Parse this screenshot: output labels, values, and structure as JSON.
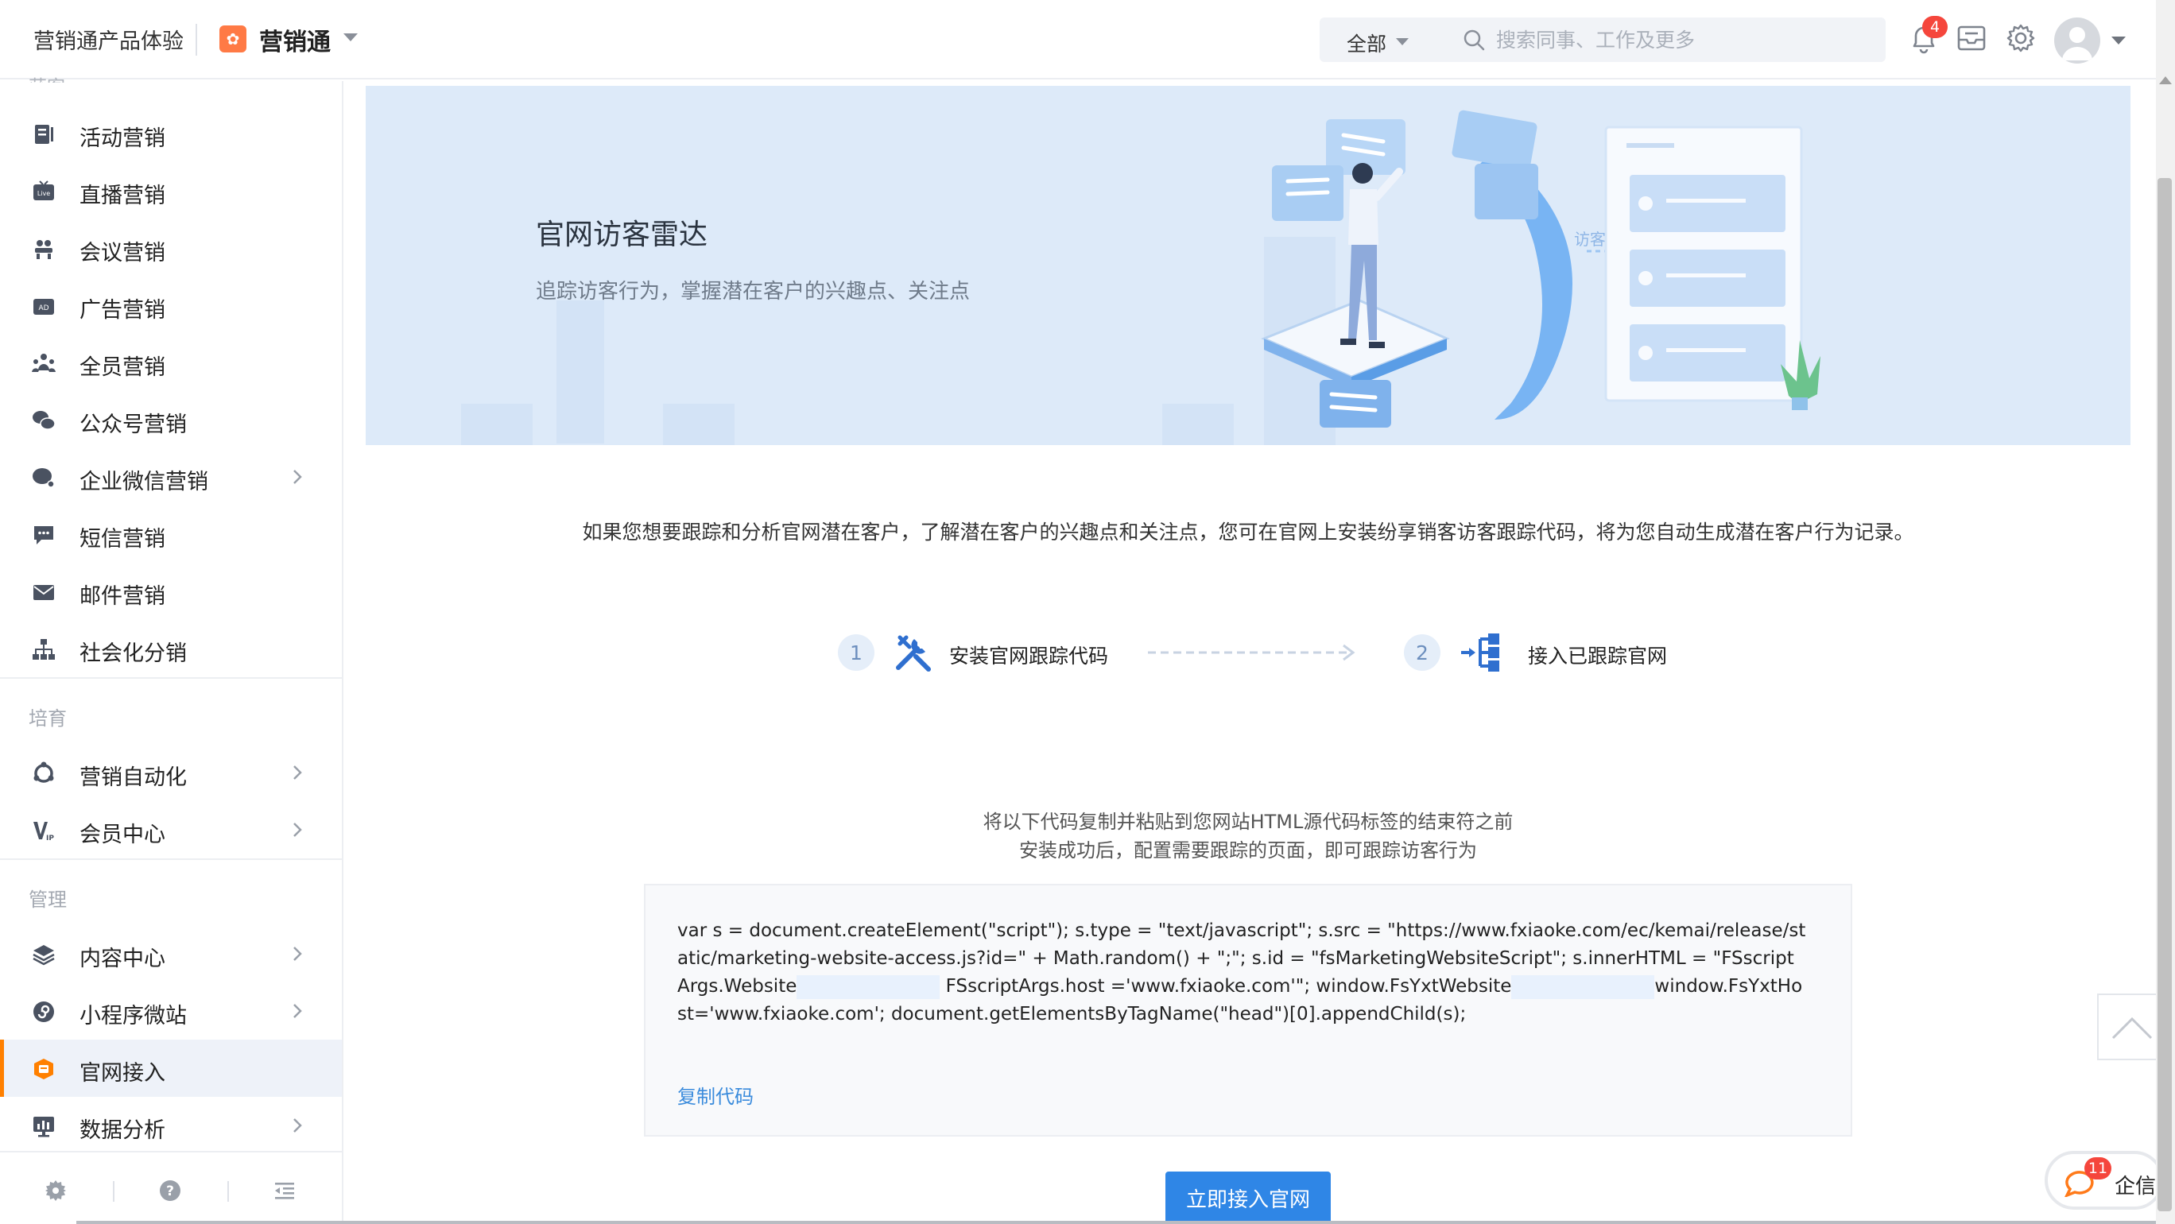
{
  "topbar": {
    "env_title": "营销通产品体验",
    "brand_name": "营销通",
    "scope": "全部",
    "search_placeholder": "搜索同事、工作及更多",
    "notification_count": "4"
  },
  "sidebar": {
    "cut_label": "获客",
    "groups": [
      {
        "items": [
          {
            "label": "活动营销",
            "icon": "activity-icon"
          },
          {
            "label": "直播营销",
            "icon": "live-icon"
          },
          {
            "label": "会议营销",
            "icon": "meeting-icon"
          },
          {
            "label": "广告营销",
            "icon": "ad-icon"
          },
          {
            "label": "全员营销",
            "icon": "people-icon"
          },
          {
            "label": "公众号营销",
            "icon": "wechat-icon"
          },
          {
            "label": "企业微信营销",
            "icon": "wecom-icon",
            "has_submenu": true
          },
          {
            "label": "短信营销",
            "icon": "sms-icon"
          },
          {
            "label": "邮件营销",
            "icon": "mail-icon"
          },
          {
            "label": "社会化分销",
            "icon": "tree-icon"
          }
        ]
      },
      {
        "title": "培育",
        "items": [
          {
            "label": "营销自动化",
            "icon": "automation-icon",
            "has_submenu": true
          },
          {
            "label": "会员中心",
            "icon": "vip-icon",
            "has_submenu": true
          }
        ]
      },
      {
        "title": "管理",
        "items": [
          {
            "label": "内容中心",
            "icon": "layers-icon",
            "has_submenu": true
          },
          {
            "label": "小程序微站",
            "icon": "miniprogram-icon",
            "has_submenu": true
          },
          {
            "label": "官网接入",
            "icon": "website-icon",
            "active": true
          },
          {
            "label": "数据分析",
            "icon": "chart-icon",
            "has_submenu": true
          }
        ]
      }
    ],
    "active_color": "#ff8000"
  },
  "banner": {
    "title": "官网访客雷达",
    "subtitle": "追踪访客行为，掌握潜在客户的兴趣点、关注点",
    "art_label": "访客行为"
  },
  "intro": "如果您想要跟踪和分析官网潜在客户，了解潜在客户的兴趣点和关注点，您可在官网上安装纷享销客访客跟踪代码，将为您自动生成潜在客户行为记录。",
  "steps": [
    {
      "number": "1",
      "label": "安装官网跟踪代码",
      "icon": "tools-icon"
    },
    {
      "number": "2",
      "label": "接入已跟踪官网",
      "icon": "connect-icon"
    }
  ],
  "instructions": {
    "line1": "将以下代码复制并粘贴到您网站HTML源代码标签的结束符之前",
    "line2": "安装成功后，配置需要跟踪的页面，即可跟踪访客行为"
  },
  "code": {
    "part1": "var s = document.createElement(\"script\"); s.type = \"text/javascript\"; s.src = \"https://www.fxiaoke.com/ec/kemai/release/static/marketing-website-access.js?id=\" + Math.random() + \";\"; s.id = \"fsMarketingWebsiteScript\"; s.innerHTML = \"FSscriptArgs.Website",
    "part2": " FSscriptArgs.host ='www.fxiaoke.com'\"; window.FsYxtWebsite",
    "part3": "window.FsYxtHost='www.fxiaoke.com'; document.getElementsByTagName(\"head\")[0].appendChild(s);",
    "copy_label": "复制代码"
  },
  "primary_button": "立即接入官网",
  "qixin": {
    "label": "企信",
    "count": "11"
  },
  "colors": {
    "primary": "#2f86e6",
    "banner_bg": "#ddeaf9",
    "badge": "#f5463c"
  }
}
